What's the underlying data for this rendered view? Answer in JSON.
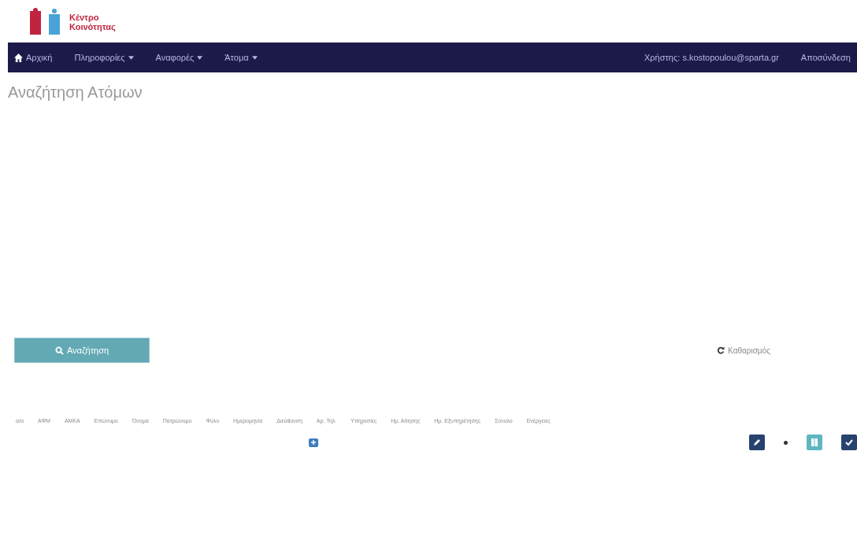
{
  "logo": {
    "line1": "Κέντρο",
    "line2": "Κοινότητας"
  },
  "nav": {
    "items": [
      {
        "label": "Αρχική",
        "kind": "home"
      },
      {
        "label": "Πληροφορίες",
        "kind": "dropdown"
      },
      {
        "label": "Αναφορές",
        "kind": "dropdown"
      },
      {
        "label": "Άτομα",
        "kind": "dropdown"
      }
    ],
    "user": "Χρήστης: s.kostopoulou@sparta.gr",
    "logout": "Αποσύνδεση"
  },
  "page_title": "Αναζήτηση Ατόμων",
  "search_button": "Αναζήτηση",
  "clear_link": "Καθαρισμός",
  "table": {
    "columns": [
      "α/α",
      "ΑΦΜ",
      "ΑΜΚΑ",
      "Επώνυμο",
      "Όνομα",
      "Πατρώνυμο",
      "Φύλο",
      "Ημερομηνία",
      "Διεύθυνση",
      "Αρ. Τηλ.",
      "Υπηρεσίες",
      "Ημ. Αίτησης",
      "Ημ. Εξυπηρέτησης",
      "Σύνολο",
      "Ενέργειες"
    ]
  }
}
